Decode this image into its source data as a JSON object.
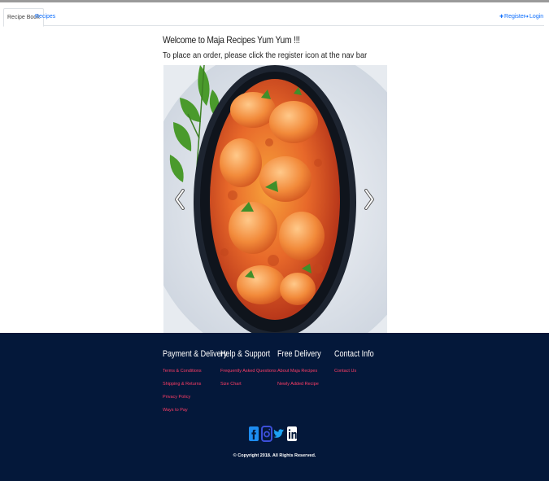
{
  "nav": {
    "tabs": [
      {
        "label": "Recipe Book",
        "active": true
      },
      {
        "label": "Recipes",
        "active": false
      }
    ],
    "register_label": "Register",
    "login_label": "Login",
    "register_icon": "user-plus-icon",
    "login_icon": "sign-in-icon"
  },
  "main": {
    "welcome": "Welcome to Maja Recipes Yum Yum !!!",
    "instruction": "To place an order, please click the register icon at the nav bar",
    "carousel": {
      "image": "curry-dish-photo",
      "prev_icon": "chevron-left-icon",
      "next_icon": "chevron-right-icon"
    }
  },
  "footer": {
    "columns": [
      {
        "title": "Payment & Delivery",
        "links": [
          "Terms & Conditions",
          "Shipping & Returns",
          "Privacy Policy",
          "Ways to Pay"
        ]
      },
      {
        "title": "Help & Support",
        "links": [
          "Frequently Asked Questions",
          "Size Chart"
        ]
      },
      {
        "title": "Free Delivery",
        "links": [
          "About Maja Recipes",
          "Newly Added Recipe"
        ]
      },
      {
        "title": "Contact Info",
        "links": [
          "Contact Us"
        ]
      }
    ],
    "social": [
      "facebook-icon",
      "instagram-icon",
      "twitter-icon",
      "linkedin-icon"
    ],
    "copyright": "© Copyright 2018. All Rights Reserved."
  },
  "colors": {
    "footer_bg": "#04183a",
    "link": "#ff3d66",
    "social": "#1da1f2",
    "nav_link": "#0d6efd"
  }
}
